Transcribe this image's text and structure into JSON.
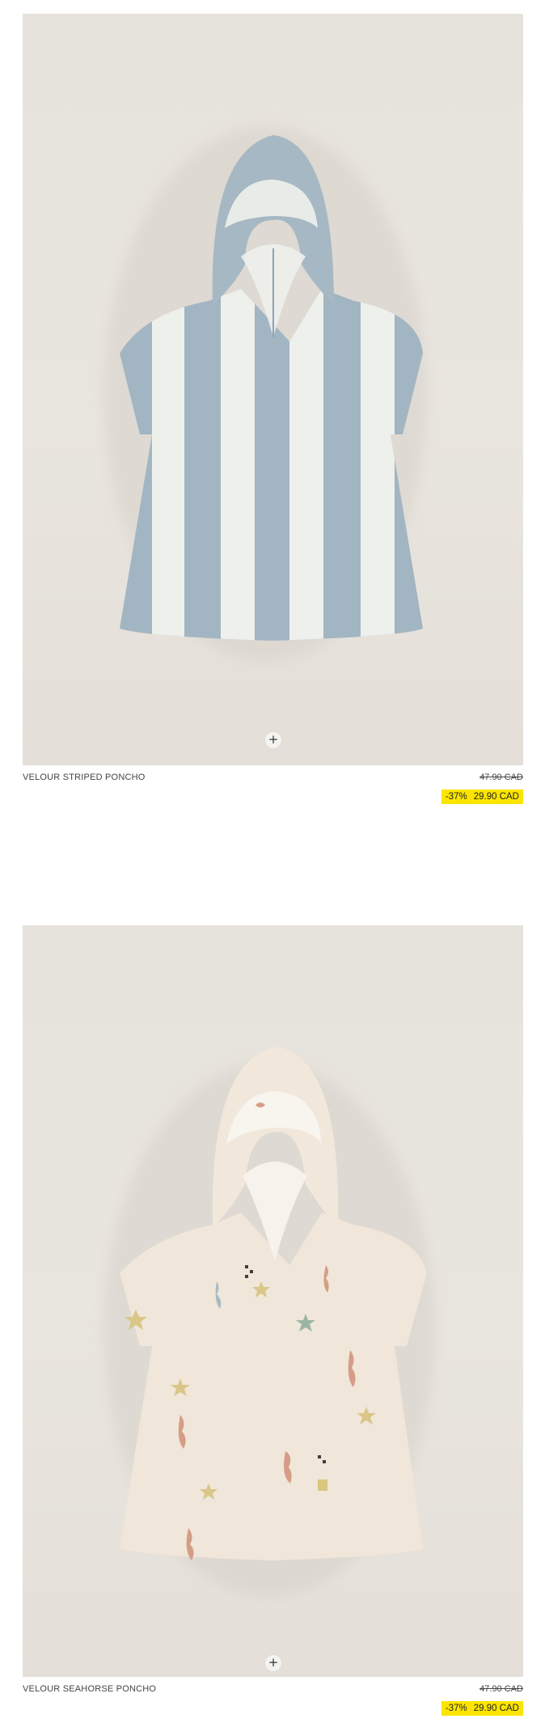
{
  "products": [
    {
      "name": "VELOUR STRIPED PONCHO",
      "old_price": "47.90 CAD",
      "discount": "-37%",
      "sale_price": "29.90 CAD",
      "quick_add": "+",
      "image_colors": {
        "main": "#a2b5c2",
        "stripe": "#eef0ec"
      }
    },
    {
      "name": "VELOUR SEAHORSE PONCHO",
      "old_price": "47.90 CAD",
      "discount": "-37%",
      "sale_price": "29.90 CAD",
      "quick_add": "+",
      "image_colors": {
        "main": "#f0e6d9",
        "print": "#d59d86"
      }
    }
  ],
  "colors": {
    "sale_highlight": "#fbe500",
    "image_background": "#e7e3dd"
  }
}
